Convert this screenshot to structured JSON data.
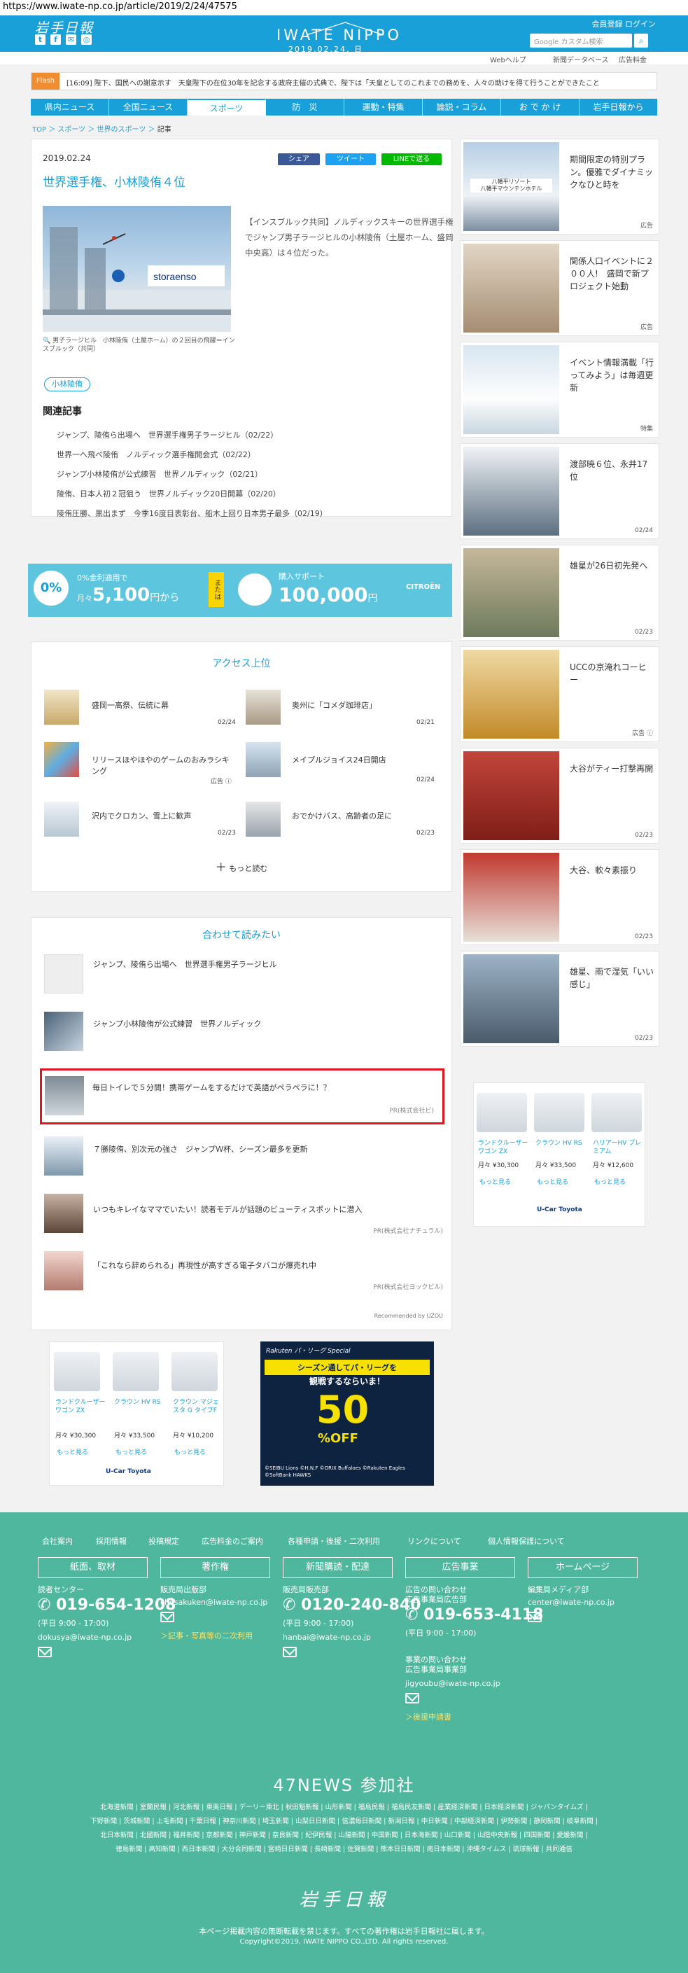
{
  "browser": {
    "url": "https://www.iwate-np.co.jp/article/2019/2/24/47575"
  },
  "header": {
    "logo_jp": "岩手日報",
    "brand": "IWATE NIPPO",
    "date": "2019.02.24. 日",
    "links": "会員登録  ログイン",
    "search_placeholder": "Google カスタム検索",
    "social_icons": [
      "twitter-icon",
      "facebook-icon",
      "mail-icon",
      "instagram-icon"
    ]
  },
  "subnav": {
    "items": [
      "Webヘルプ",
      "新聞データベース",
      "広告料金"
    ]
  },
  "flash": {
    "label": "Flash",
    "text": "[16:09] 陛下、国民への謝意示す　天皇陛下の在位30年を記念する政府主催の式典で、陛下は「天皇としてのこれまでの務めを、人々の助けを得て行うことができたこと"
  },
  "gnav": [
    "県内ニュース",
    "全国ニュース",
    "スポーツ",
    "防　災",
    "運動・特集",
    "論説・コラム",
    "お で か け",
    "岩手日報から"
  ],
  "breadcrumb": {
    "top": "TOP",
    "sports": "スポーツ",
    "world": "世界のスポーツ",
    "current": "記事"
  },
  "article": {
    "date": "2019.02.24",
    "title": "世界選手権、小林陵侑４位",
    "share_fb": "シェア",
    "share_tw": "ツイート",
    "share_line": "LINEで送る",
    "caption": "男子ラージヒル　小林陵侑（土屋ホーム）の２回目の飛躍＝インスブルック（共同）",
    "body": "【インスブルック共同】ノルディックスキーの世界選手権でジャンプ男子ラージヒルの小林陵侑（土屋ホーム、盛岡中央高）は４位だった。",
    "tag": "小林陵侑",
    "related_heading": "関連記事",
    "related": [
      "ジャンプ、陵侑ら出場へ　世界選手権男子ラージヒル（02/22）",
      "世界一へ飛べ陵侑　ノルディック選手権開会式（02/22）",
      "ジャンプ小林陵侑が公式練習　世界ノルディック（02/21）",
      "陵侑、日本人初２冠狙う　世界ノルディック20日開幕（02/20）",
      "陵侑圧勝、黒出まず　今季16度目表彰台、船木上回り日本男子最多（02/19）"
    ]
  },
  "banner_ad": {
    "rate": "0%",
    "rate_label": "0%金利適用で",
    "monthly_prefix": "月々",
    "monthly": "5,100",
    "monthly_suffix": "円から",
    "or": "または",
    "support_label": "購入サポート",
    "support_amount": "100,000",
    "support_suffix": "円",
    "brand": "CITROËN"
  },
  "access": {
    "title": "アクセス上位",
    "items": [
      {
        "text": "盛岡一高祭、伝統に幕",
        "date": "02/24"
      },
      {
        "text": "奥州に「コメダ珈琲店」",
        "date": "02/21"
      },
      {
        "text": "リリースほやほやのゲームのおみラシキング",
        "date": "広告 ⓘ"
      },
      {
        "text": "メイプルジョイス24日開店",
        "date": "02/24"
      },
      {
        "text": "沢内でクロカン、雪上に歓声",
        "date": "02/23"
      },
      {
        "text": "おでかけバス、高齢者の足に",
        "date": "02/23"
      }
    ],
    "more": "もっと読む"
  },
  "recommend": {
    "title": "合わせて読みたい",
    "items": [
      {
        "text": "ジャンプ、陵侑ら出場へ　世界選手権男子ラージヒル",
        "pr": ""
      },
      {
        "text": "ジャンプ小林陵侑が公式練習　世界ノルディック",
        "pr": ""
      },
      {
        "text": "毎日トイレで５分間！携帯ゲームをするだけで英語がペラペラに！？",
        "pr": "PR(株式会社ビ)"
      },
      {
        "text": "７勝陵侑、別次元の強さ　ジャンプＷ杯、シーズン最多を更新",
        "pr": ""
      },
      {
        "text": "いつもキレイなママでいたい！読者モデルが話題のビューティスポットに潜入",
        "pr": "PR(株式会社ナチュラル)"
      },
      {
        "text": "「これなら辞められる」再現性が高すぎる電子タバコが爆売れ中",
        "pr": "PR(株式会社ヨックビル)"
      }
    ],
    "powered": "Recommended by UZOU"
  },
  "side": [
    {
      "text": "期間限定の特別プラン。優雅でダイナミックなひと時を",
      "date": "広告",
      "overlay": "八幡平リゾート\n八幡平マウンテンホテル"
    },
    {
      "text": "関係人口イベントに２００人!　盛岡で新プロジェクト始動",
      "date": "広告"
    },
    {
      "text": "イベント情報満載「行ってみよう」は毎週更新",
      "date": "特集"
    },
    {
      "text": "渡部暁６位、永井17位",
      "date": "02/24"
    },
    {
      "text": "雄星が26日初先発へ",
      "date": "02/23"
    },
    {
      "text": "UCCの京淹れコーヒー",
      "date": "広告 ⓘ"
    },
    {
      "text": "大谷がティー打撃再開",
      "date": "02/23"
    },
    {
      "text": "大谷、軟々素振り",
      "date": "02/23"
    },
    {
      "text": "雄星、雨で湿気「いい感じ」",
      "date": "02/23"
    }
  ],
  "car_ad_side": {
    "cars": [
      {
        "name": "ランドクルーザーワゴン ZX",
        "price": "月々 ¥30,300"
      },
      {
        "name": "クラウン HV RS",
        "price": "月々 ¥33,500"
      },
      {
        "name": "ハリアーHV プレミアム",
        "price": "月々 ¥12,600"
      }
    ],
    "btn": "もっと見る",
    "logo": "U-Car Toyota"
  },
  "car_ad_bottom": {
    "cars": [
      {
        "name": "ランドクルーザーワゴン ZX",
        "price": "月々 ¥30,300"
      },
      {
        "name": "クラウン HV RS",
        "price": "月々 ¥33,500"
      },
      {
        "name": "クラウン マジェスタ G タイプF",
        "price": "月々 ¥10,200"
      }
    ],
    "btn": "もっと見る",
    "logo": "U-Car Toyota"
  },
  "pacific_ad": {
    "top": "Rakuten パ・リーグ Special",
    "mid1": "シーズン通してパ・リーグを",
    "mid2": "観戦するならいま！",
    "off": "50",
    "pct": "%OFF",
    "foot": "©SEIBU Lions ©H.N.F ©ORIX Buffaloes ©Rakuten Eagles ©SoftBank HAWKS"
  },
  "footer": {
    "links": [
      "会社案内",
      "採用情報",
      "投稿規定",
      "広告料金のご案内",
      "各種申請・後援・二次利用",
      "リンクについて",
      "個人情報保護について"
    ],
    "cols": [
      {
        "box": "紙面、取材",
        "label": "読者センター",
        "phone": "019-654-1208",
        "hours": "(平日 9:00 - 17:00)",
        "mail": "dokusya@iwate-np.co.jp"
      },
      {
        "box": "著作権",
        "label": "販売局出版部",
        "mail": "chosakuken@iwate-np.co.jp",
        "link": "＞記事・写真等の二次利用"
      },
      {
        "box": "新聞購読・配達",
        "label": "販売局販売部",
        "phone": "0120-240-840",
        "hours": "(平日 9:00 - 17:00)",
        "mail": "hanbai@iwate-np.co.jp"
      },
      {
        "box": "広告事業",
        "label": "広告の問い合わせ\n広告事業局広告部",
        "phone": "019-653-4118",
        "hours": "(平日 9:00 - 17:00)",
        "label2": "事業の問い合わせ\n広告事業局事業部",
        "mail2": "jigyoubu@iwate-np.co.jp",
        "link": "＞後援申請書"
      },
      {
        "box": "ホームページ",
        "label": "編集局メディア部",
        "mail": "center@iwate-np.co.jp"
      }
    ],
    "n47": "47NEWS 参加社",
    "papers": [
      "北海道新聞 | 室蘭民報 | 河北新報 | 東奥日報 | デーリー東北 | 秋田魁新報 | 山形新聞 | 福島民報 | 福島民友新聞 | 産業経済新聞 | 日本経済新聞 | ジャパンタイムズ |",
      "下野新聞 | 茨城新聞 | 上毛新聞 | 千葉日報 | 神奈川新聞 | 埼玉新聞 | 山梨日日新聞 | 信濃毎日新聞 | 新潟日報 | 中日新聞 | 中部経済新聞 | 伊勢新聞 | 静岡新聞 | 岐阜新聞 |",
      "北日本新聞 | 北國新聞 | 福井新聞 | 京都新聞 | 神戸新聞 | 奈良新聞 | 紀伊民報 | 山陽新聞 | 中国新聞 | 日本海新聞 | 山口新聞 | 山陰中央新報 | 四国新聞 | 愛媛新聞 |",
      "徳島新聞 | 高知新聞 | 西日本新聞 | 大分合同新聞 | 宮崎日日新聞 | 長崎新聞 | 佐賀新聞 | 熊本日日新聞 | 南日本新聞 | 沖縄タイムス | 琉球新報 | 共同通信"
    ],
    "logo": "岩手日報",
    "notice": "本ページ掲載内容の無断転載を禁じます。すべての著作権は岩手日報社に属します。",
    "copyright": "Copyright©2019, IWATE NIPPO CO.,LTD. All rights reserved."
  },
  "colors": {
    "brand_blue": "#1aa0d8",
    "footer_green": "#4fb79d",
    "flash_orange": "#f08c32",
    "ad_highlight": "#e0141e"
  }
}
